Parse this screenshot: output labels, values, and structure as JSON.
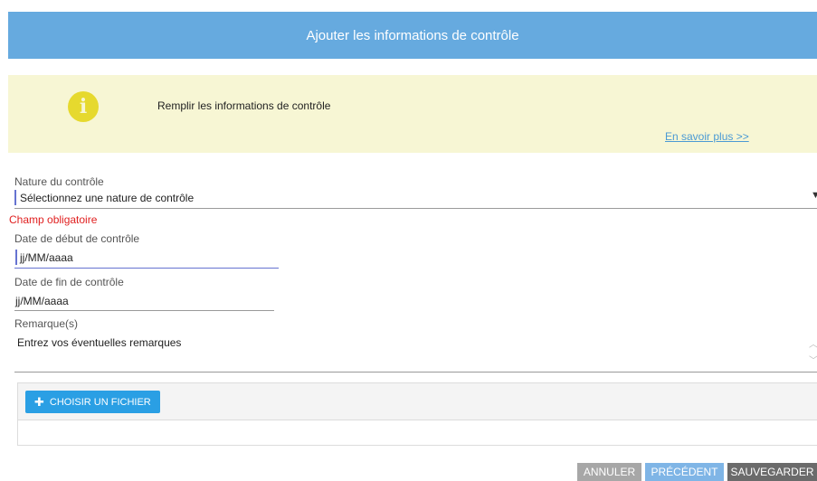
{
  "header": {
    "title": "Ajouter les informations de contrôle"
  },
  "info": {
    "icon": "info-icon",
    "text": "Remplir les informations de contrôle",
    "link": "En savoir plus >>"
  },
  "form": {
    "nature": {
      "label": "Nature du contrôle",
      "value": "Sélectionnez une nature de contrôle",
      "error": "Champ obligatoire"
    },
    "start_date": {
      "label": "Date de début de contrôle",
      "placeholder": "jj/MM/aaaa"
    },
    "end_date": {
      "label": "Date de fin de contrôle",
      "placeholder": "jj/MM/aaaa"
    },
    "remarks": {
      "label": "Remarque(s)",
      "placeholder": "Entrez vos éventuelles remarques"
    }
  },
  "upload": {
    "button_label": "CHOISIR UN FICHIER",
    "button_icon": "plus-icon"
  },
  "actions": {
    "cancel": "ANNULER",
    "previous": "PRÉCÉDENT",
    "save": "SAUVEGARDER"
  },
  "colors": {
    "header_bg": "#66aadf",
    "info_bg": "#f7f6d4",
    "info_icon": "#e6d92e",
    "error": "#e02020",
    "primary_button": "#2a9fe4",
    "previous_button": "#7fb5e6",
    "cancel_button": "#a7a7a7",
    "save_button": "#6b6b6b"
  }
}
